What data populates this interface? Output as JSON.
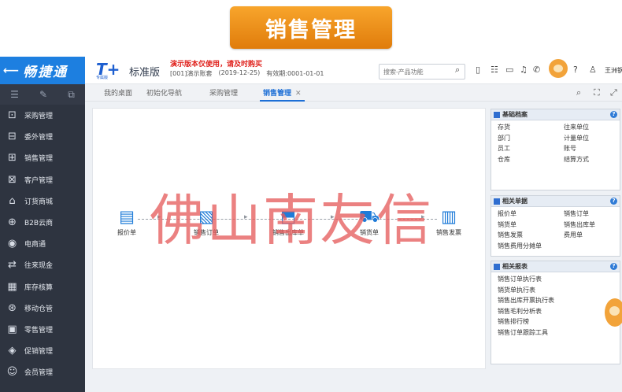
{
  "banner": {
    "title": "销售管理"
  },
  "sidebar": {
    "brand": "畅捷通",
    "items": [
      {
        "label": "采购管理",
        "icon": "purchase-icon"
      },
      {
        "label": "委外管理",
        "icon": "outsourcing-icon"
      },
      {
        "label": "销售管理",
        "icon": "sales-icon"
      },
      {
        "label": "客户管理",
        "icon": "customer-icon"
      },
      {
        "label": "订货商城",
        "icon": "mall-icon"
      },
      {
        "label": "B2B云商",
        "icon": "b2b-icon"
      },
      {
        "label": "电商通",
        "icon": "ecommerce-icon"
      },
      {
        "label": "往来现金",
        "icon": "cash-icon"
      },
      {
        "label": "库存核算",
        "icon": "inventory-icon"
      },
      {
        "label": "移动仓管",
        "icon": "mobile-warehouse-icon"
      },
      {
        "label": "零售管理",
        "icon": "retail-icon"
      },
      {
        "label": "促销管理",
        "icon": "promotion-icon"
      },
      {
        "label": "会员管理",
        "icon": "member-icon"
      }
    ]
  },
  "header": {
    "logo": "T+",
    "logo_sub": "专属版",
    "edition": "标准版",
    "demo_note": "演示版本仅使用，请及时购买",
    "account": "[001]演示账套",
    "date": "(2019-12-25)",
    "validity": "有效期:0001-01-01",
    "search_placeholder": "搜索-产品功能",
    "user": "王洲钢"
  },
  "tabs": [
    {
      "label": "我的桌面",
      "active": false
    },
    {
      "label": "初始化导航",
      "active": false
    },
    {
      "label": "采购管理",
      "active": false
    },
    {
      "label": "销售管理",
      "active": true
    }
  ],
  "flow": {
    "nodes": [
      "报价单",
      "销售订单",
      "销售出库单",
      "销货单",
      "销售发票"
    ]
  },
  "watermark": "佛山南友信",
  "panels": {
    "basic": {
      "title": "基础档案",
      "col1": [
        "存货",
        "部门",
        "员工",
        "仓库"
      ],
      "col2": [
        "往来单位",
        "计量单位",
        "账号",
        "结算方式"
      ]
    },
    "docs": {
      "title": "相关单据",
      "col1": [
        "报价单",
        "销货单",
        "销售发票",
        "销售费用分摊单"
      ],
      "col2": [
        "销售订单",
        "销售出库单",
        "费用单"
      ]
    },
    "reports": {
      "title": "相关报表",
      "items": [
        "销售订单执行表",
        "销货单执行表",
        "销售出库开票执行表",
        "销售毛利分析表",
        "销售排行榜",
        "销售订单跟踪工具"
      ]
    }
  },
  "colors": {
    "accent": "#1d7fe0",
    "sidebar_bg": "#2e3440",
    "banner": "#f39a1e",
    "watermark": "#e55d5d"
  }
}
